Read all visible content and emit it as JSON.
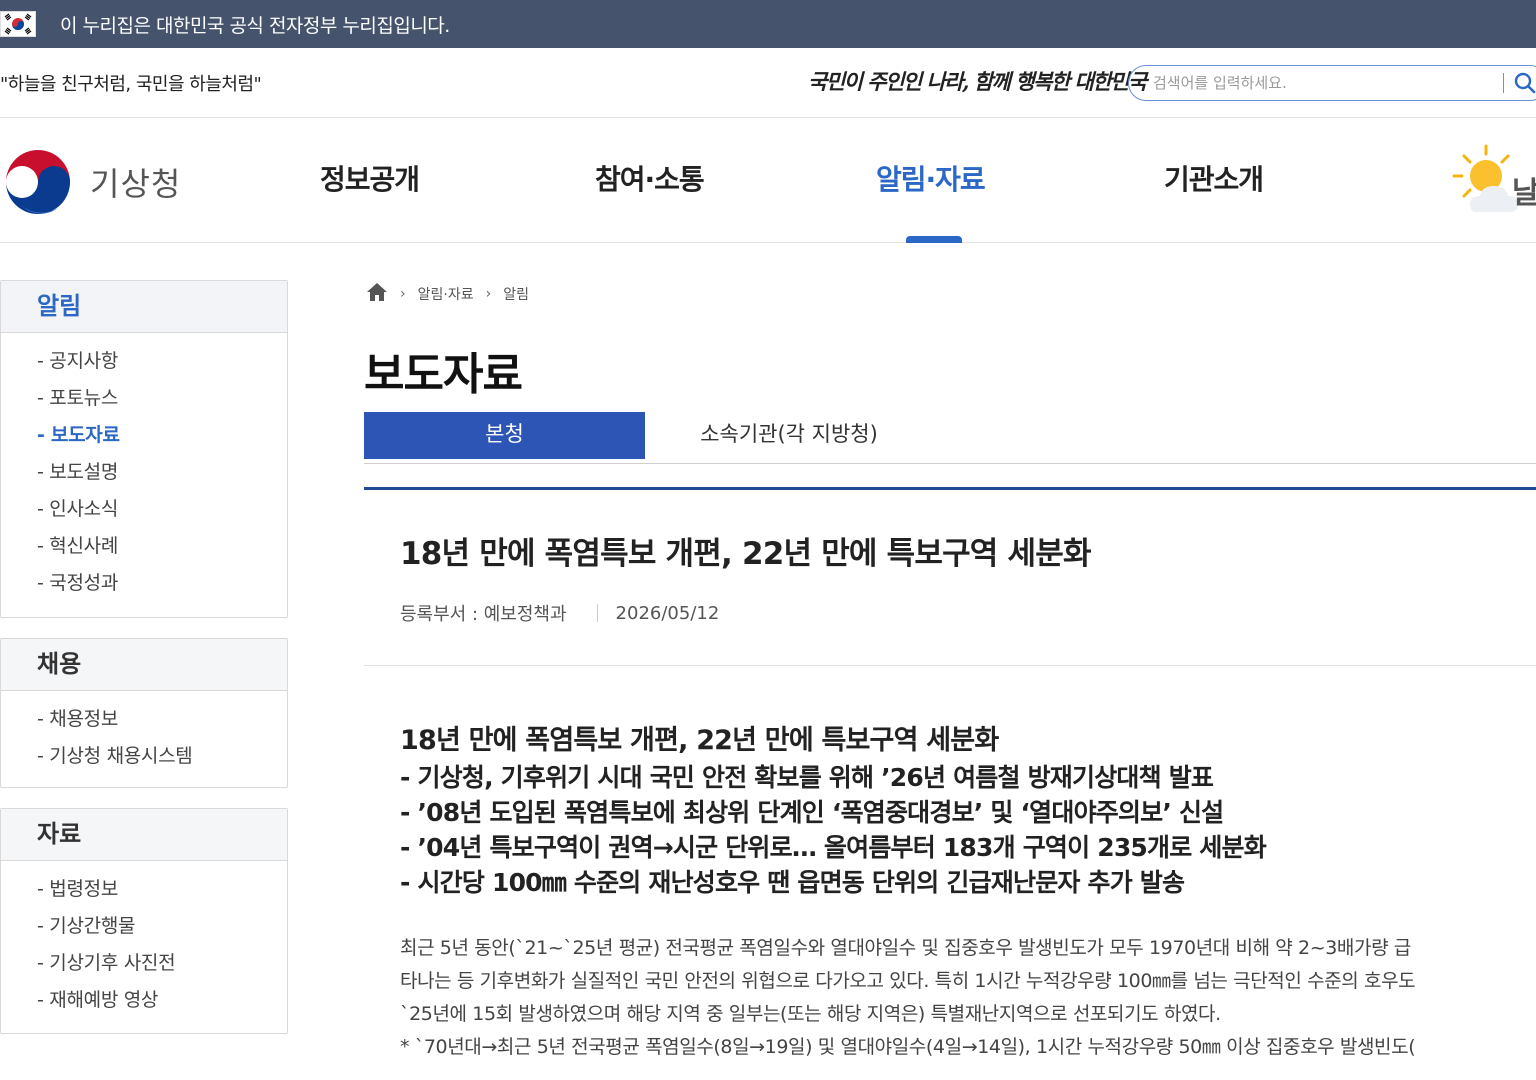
{
  "gov_banner": {
    "text": "이 누리집은 대한민국 공식 전자정부 누리집입니다."
  },
  "slogan": {
    "left": "\"하늘을 친구처럼, 국민을 하늘처럼\"",
    "right": "국민이 주인인 나라, 함께 행복한 대한민국"
  },
  "search": {
    "placeholder": "검색어를 입력하세요."
  },
  "logo": {
    "text": "기상청"
  },
  "nav": {
    "items": [
      "정보공개",
      "참여·소통",
      "알림·자료",
      "기관소개"
    ],
    "active": "알림·자료",
    "weather_label": "날"
  },
  "sidebar": {
    "sections": [
      {
        "title": "알림",
        "items": [
          "- 공지사항",
          "- 포토뉴스",
          "- 보도자료",
          "- 보도설명",
          "- 인사소식",
          "- 혁신사례",
          "- 국정성과"
        ],
        "active_item": "- 보도자료"
      },
      {
        "title": "채용",
        "items": [
          "- 채용정보",
          "- 기상청 채용시스템"
        ]
      },
      {
        "title": "자료",
        "items": [
          "- 법령정보",
          "- 기상간행물",
          "- 기상기후 사진전",
          "- 재해예방 영상"
        ]
      }
    ]
  },
  "breadcrumb": {
    "items": [
      "알림·자료",
      "알림"
    ]
  },
  "page": {
    "title": "보도자료"
  },
  "tabs": {
    "items": [
      "본청",
      "소속기관(각 지방청)"
    ],
    "active": "본청"
  },
  "article": {
    "title": "18년 만에 폭염특보 개편, 22년 만에 특보구역 세분화",
    "department_label": "등록부서 : 예보정책과",
    "date": "2026/05/12",
    "summary_title": "18년 만에 폭염특보 개편, 22년 만에 특보구역 세분화",
    "summary_lines": [
      "- 기상청, 기후위기 시대 국민 안전 확보를 위해 ’26년 여름철 방재기상대책 발표",
      "- ’08년 도입된 폭염특보에 최상위 단계인 ‘폭염중대경보’ 및 ‘열대야주의보’ 신설",
      "- ’04년 특보구역이 권역→시군 단위로… 올여름부터 183개 구역이 235개로 세분화",
      "- 시간당 100㎜ 수준의 재난성호우 땐 읍면동 단위의 긴급재난문자 추가 발송"
    ],
    "body_lines": [
      "최근 5년 동안(`21~`25년 평균) 전국평균 폭염일수와 열대야일수 및 집중호우 발생빈도가 모두 1970년대 비해 약 2~3배가량 급",
      "타나는 등 기후변화가 실질적인 국민 안전의 위협으로 다가오고 있다. 특히 1시간 누적강우량 100㎜를 넘는 극단적인 수준의 호우도",
      "`25년에 15회 발생하였으며 해당 지역 중 일부는(또는 해당 지역은) 특별재난지역으로 선포되기도 하였다.",
      "* `70년대→최근 5년 전국평균 폭염일수(8일→19일) 및 열대야일수(4일→14일), 1시간 누적강우량 50㎜ 이상 집중호우 발생빈도("
    ]
  }
}
